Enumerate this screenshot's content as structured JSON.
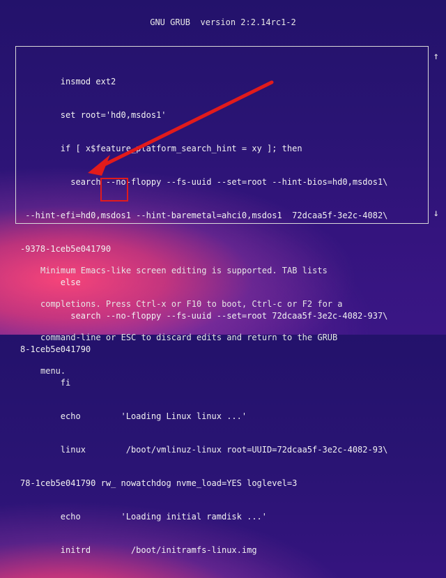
{
  "header": {
    "title": "GNU GRUB  version 2:2.14rc1-2"
  },
  "editor": {
    "lines": [
      "        insmod ext2",
      "        set root='hd0,msdos1'",
      "        if [ x$feature_platform_search_hint = xy ]; then",
      "          search --no-floppy --fs-uuid --set=root --hint-bios=hd0,msdos1\\",
      " --hint-efi=hd0,msdos1 --hint-baremetal=ahci0,msdos1  72dcaa5f-3e2c-4082\\",
      "-9378-1ceb5e041790",
      "        else",
      "          search --no-floppy --fs-uuid --set=root 72dcaa5f-3e2c-4082-937\\",
      "8-1ceb5e041790",
      "        fi",
      "        echo        'Loading Linux linux ...'",
      "        linux        /boot/vmlinuz-linux root=UUID=72dcaa5f-3e2c-4082-93\\",
      "78-1ceb5e041790 rw_ nowatchdog nvme_load=YES loglevel=3",
      "        echo        'Loading initial ramdisk ...'",
      "        initrd        /boot/initramfs-linux.img"
    ],
    "scroll_up": "↑",
    "scroll_down": "↓"
  },
  "help": {
    "lines": [
      "Minimum Emacs-like screen editing is supported. TAB lists",
      "completions. Press Ctrl-x or F10 to boot, Ctrl-c or F2 for a",
      "command-line or ESC to discard edits and return to the GRUB",
      "menu."
    ]
  },
  "annotation": {
    "color": "#e21b1b"
  }
}
